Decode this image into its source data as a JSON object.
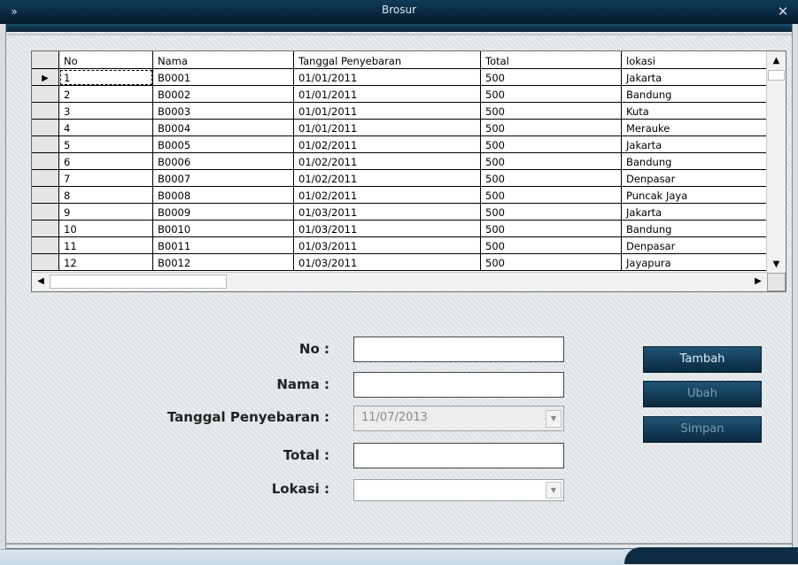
{
  "window": {
    "title": "Brosur"
  },
  "grid": {
    "columns": [
      "No",
      "Nama",
      "Tanggal Penyebaran",
      "Total",
      "lokasi"
    ],
    "rows": [
      [
        "1",
        "B0001",
        "01/01/2011",
        "500",
        "Jakarta"
      ],
      [
        "2",
        "B0002",
        "01/01/2011",
        "500",
        "Bandung"
      ],
      [
        "3",
        "B0003",
        "01/01/2011",
        "500",
        "Kuta"
      ],
      [
        "4",
        "B0004",
        "01/01/2011",
        "500",
        "Merauke"
      ],
      [
        "5",
        "B0005",
        "01/02/2011",
        "500",
        "Jakarta"
      ],
      [
        "6",
        "B0006",
        "01/02/2011",
        "500",
        "Bandung"
      ],
      [
        "7",
        "B0007",
        "01/02/2011",
        "500",
        "Denpasar"
      ],
      [
        "8",
        "B0008",
        "01/02/2011",
        "500",
        "Puncak Jaya"
      ],
      [
        "9",
        "B0009",
        "01/03/2011",
        "500",
        "Jakarta"
      ],
      [
        "10",
        "B0010",
        "01/03/2011",
        "500",
        "Bandung"
      ],
      [
        "11",
        "B0011",
        "01/03/2011",
        "500",
        "Denpasar"
      ],
      [
        "12",
        "B0012",
        "01/03/2011",
        "500",
        "Jayapura"
      ]
    ],
    "current_row_marker": "▶"
  },
  "form": {
    "no_label": "No :",
    "nama_label": "Nama :",
    "tanggal_label": "Tanggal Penyebaran :",
    "tanggal_value": "11/07/2013",
    "total_label": "Total :",
    "lokasi_label": "Lokasi :"
  },
  "buttons": {
    "tambah": "Tambah",
    "ubah": "Ubah",
    "simpan": "Simpan"
  },
  "icons": {
    "system_menu": "chevron-right-icon",
    "close": "close-icon"
  }
}
